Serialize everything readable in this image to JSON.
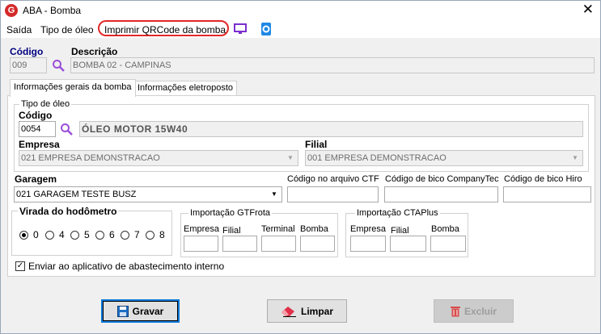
{
  "window": {
    "title": "ABA - Bomba",
    "app_icon": "G",
    "close_glyph": "✕"
  },
  "menu": {
    "items": [
      "Saída",
      "Tipo de óleo",
      "Imprimir QRCode da bomba"
    ],
    "highlight_color": "#e32727"
  },
  "top": {
    "codigo_label": "Código",
    "codigo_value": "009",
    "descricao_label": "Descrição",
    "descricao_value": "BOMBA  02 - CAMPINAS"
  },
  "tabs": [
    "Informações gerais da bomba",
    "Informações eletroposto"
  ],
  "tipo_oleo": {
    "legend": "Tipo de óleo",
    "codigo_label": "Código",
    "codigo_value": "0054",
    "descricao_value": "ÓLEO MOTOR 15W40",
    "empresa_label": "Empresa",
    "empresa_value": "021 EMPRESA DEMONSTRACAO",
    "filial_label": "Filial",
    "filial_value": "001 EMPRESA DEMONSTRACAO"
  },
  "garagem": {
    "label": "Garagem",
    "value": "021 GARAGEM TESTE BUSZ"
  },
  "codes": {
    "ctf_label": "Código no arquivo CTF",
    "companytec_label": "Código de bico CompanyTec",
    "hiro_label": "Código de bico Hiro",
    "ctf_value": "",
    "companytec_value": "",
    "hiro_value": ""
  },
  "hodometro": {
    "legend": "Virada do hodômetro",
    "options": [
      "0",
      "4",
      "5",
      "6",
      "7",
      "8"
    ],
    "selected": "0"
  },
  "gtfrota": {
    "legend": "Importação GTFrota",
    "labels": [
      "Empresa",
      "Filial",
      "Terminal",
      "Bomba"
    ]
  },
  "ctaplus": {
    "legend": "Importação CTAPlus",
    "labels": [
      "Empresa",
      "Filial",
      "Bomba"
    ]
  },
  "enviar": {
    "label": "Enviar ao aplicativo de abastecimento interno",
    "checked": true,
    "check_glyph": "✓"
  },
  "buttons": {
    "gravar": "Gravar",
    "limpar": "Limpar",
    "excluir": "Excluir"
  },
  "colors": {
    "accent": "#0078d7",
    "brand": "#d42a2a"
  }
}
